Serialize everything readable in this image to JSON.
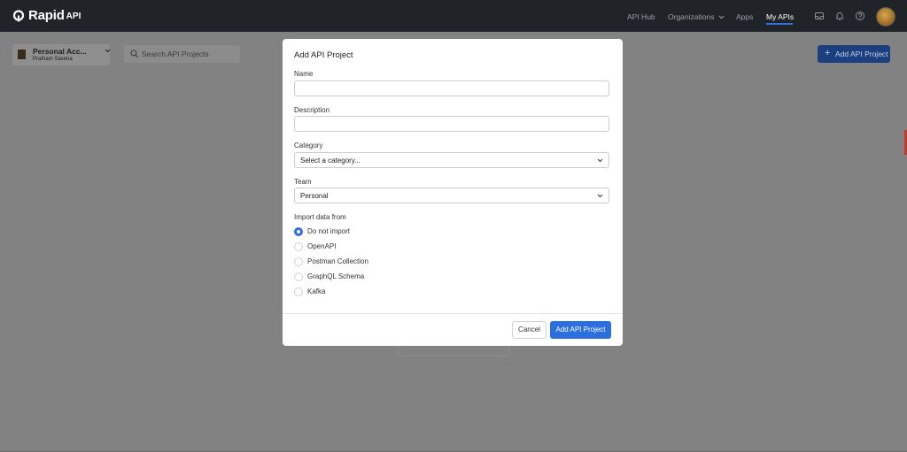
{
  "brand": {
    "name": "Rapid",
    "suffix": "API"
  },
  "nav": {
    "items": [
      "API Hub",
      "Organizations",
      "Apps",
      "My APIs"
    ],
    "active": "My APIs"
  },
  "icons": {
    "inbox": "inbox-icon",
    "bell": "bell-icon",
    "help": "help-icon"
  },
  "account": {
    "name": "Personal Acc...",
    "user": "Pratham Saxena"
  },
  "search": {
    "placeholder": "Search API Projects"
  },
  "page": {
    "add_button": "Add API Project"
  },
  "modal": {
    "title": "Add API Project",
    "name_label": "Name",
    "name_value": "",
    "description_label": "Description",
    "description_value": "",
    "category_label": "Category",
    "category_value": "Select a category...",
    "team_label": "Team",
    "team_value": "Personal",
    "import_label": "Import data from",
    "import_options": [
      "Do not import",
      "OpenAPI",
      "Postman Collection",
      "GraphQL Schema",
      "Kafka"
    ],
    "import_selected": "Do not import",
    "cancel": "Cancel",
    "submit": "Add API Project"
  },
  "colors": {
    "accent": "#2b6fde",
    "topbar": "#202328",
    "overlay": "#828282"
  }
}
